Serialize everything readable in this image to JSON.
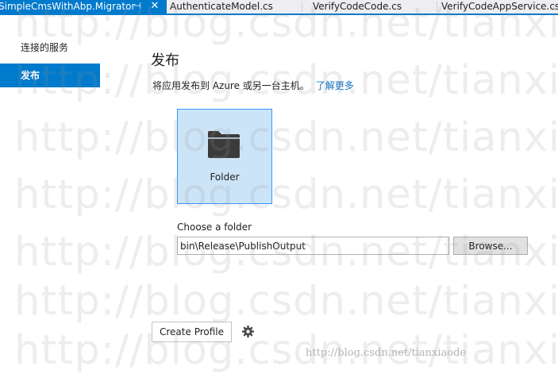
{
  "tabs": [
    {
      "title": "SimpleCmsWithAbp.Migrator",
      "active": true
    },
    {
      "title": "AuthenticateModel.cs",
      "active": false
    },
    {
      "title": "VerifyCodeCode.cs",
      "active": false
    },
    {
      "title": "VerifyCodeAppService.cs",
      "active": false
    }
  ],
  "sidebar": {
    "items": [
      {
        "label": "连接的服务",
        "selected": false
      },
      {
        "label": "发布",
        "selected": true
      }
    ]
  },
  "main": {
    "title": "发布",
    "description": "将应用发布到 Azure 或另一台主机。",
    "learn_more": "了解更多",
    "target": {
      "label": "Folder",
      "icon": "folder-icon"
    },
    "folder_label": "Choose a folder",
    "folder_value": "bin\\Release\\PublishOutput",
    "browse_label": "Browse...",
    "create_profile_label": "Create Profile",
    "settings_icon": "gear-icon"
  },
  "watermark": {
    "text": "http://blog.csdn.net/tianxia",
    "corner": "http://blog.csdn.net/tianxiaode"
  },
  "colors": {
    "accent": "#007acc",
    "tile_bg": "#cce4f7",
    "link": "#0e70c0"
  }
}
